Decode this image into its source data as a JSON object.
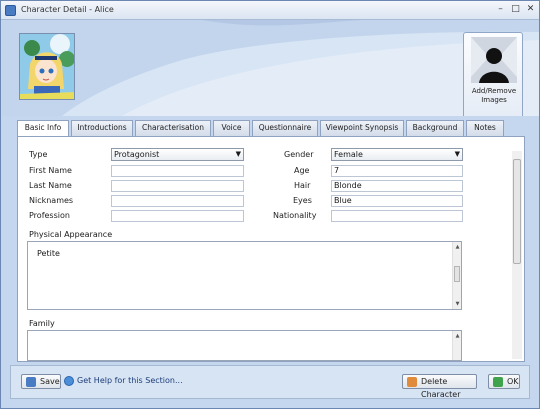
{
  "window": {
    "title": "Character Detail - Alice"
  },
  "header": {
    "add_images_label": "Add/Remove Images"
  },
  "tabs": [
    "Basic Info",
    "Introductions",
    "Characterisation",
    "Voice",
    "Questionnaire",
    "Viewpoint Synopsis",
    "Background",
    "Notes"
  ],
  "form": {
    "type_label": "Type",
    "type_value": "Protagonist",
    "first_name_label": "First Name",
    "first_name_value": "",
    "last_name_label": "Last Name",
    "last_name_value": "",
    "nicknames_label": "Nicknames",
    "nicknames_value": "",
    "profession_label": "Profession",
    "profession_value": "",
    "gender_label": "Gender",
    "gender_value": "Female",
    "age_label": "Age",
    "age_value": "7",
    "hair_label": "Hair",
    "hair_value": "Blonde",
    "eyes_label": "Eyes",
    "eyes_value": "Blue",
    "nationality_label": "Nationality",
    "nationality_value": "",
    "physical_label": "Physical Appearance",
    "physical_value": "Petite",
    "family_label": "Family",
    "family_value": ""
  },
  "footer": {
    "save_label": "Save",
    "help_label": "Get Help for this Section...",
    "delete_label": "Delete Character",
    "ok_label": "OK"
  },
  "colors": {
    "accent": "#4a7cc4",
    "panel": "#ffffff",
    "window_bg": "#c5d7ee"
  }
}
